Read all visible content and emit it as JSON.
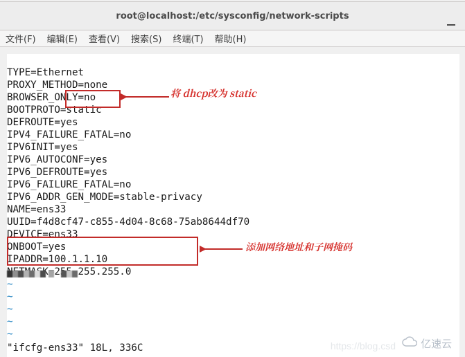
{
  "window": {
    "title": "root@localhost:/etc/sysconfig/network-scripts"
  },
  "menu": {
    "file": "文件(F)",
    "edit": "编辑(E)",
    "view": "查看(V)",
    "search": "搜索(S)",
    "terminal": "终端(T)",
    "help": "帮助(H)"
  },
  "file_lines": [
    "TYPE=Ethernet",
    "PROXY_METHOD=none",
    "BROWSER_ONLY=no",
    "BOOTPROTO=static",
    "DEFROUTE=yes",
    "IPV4_FAILURE_FATAL=no",
    "IPV6INIT=yes",
    "IPV6_AUTOCONF=yes",
    "IPV6_DEFROUTE=yes",
    "IPV6_FAILURE_FATAL=no",
    "IPV6_ADDR_GEN_MODE=stable-privacy",
    "NAME=ens33",
    "UUID=f4d8cf47-c855-4d04-8c68-75ab8644df70",
    "DEVICE=ens33",
    "ONBOOT=yes",
    "IPADDR=100.1.1.10",
    "NETMASK=255.255.255.0"
  ],
  "tilde_lines": [
    "~",
    "~",
    "~",
    "~",
    "~"
  ],
  "status_line": "\"ifcfg-ens33\" 18L, 336C",
  "annotations": {
    "a1": "将 dhcp改为 static",
    "a2": "添加网络地址和子网掩码"
  },
  "watermark": {
    "brand": "亿速云",
    "url": "https://blog.csd"
  }
}
